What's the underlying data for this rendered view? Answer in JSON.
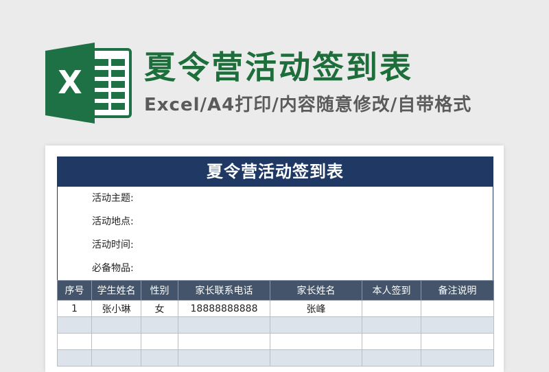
{
  "header": {
    "title": "夏令营活动签到表",
    "subtitle": "Excel/A4打印/内容随意修改/自带格式",
    "logo_letter": "X"
  },
  "sheet": {
    "title": "夏令营活动签到表",
    "info": [
      "活动主题:",
      "活动地点:",
      "活动时间:",
      "必备物品:"
    ],
    "columns": [
      "序号",
      "学生姓名",
      "性别",
      "家长联系电话",
      "家长姓名",
      "本人签到",
      "备注说明"
    ],
    "rows": [
      [
        "1",
        "张小琳",
        "女",
        "18888888888",
        "张峰",
        "",
        ""
      ],
      [
        "",
        "",
        "",
        "",
        "",
        "",
        ""
      ],
      [
        "",
        "",
        "",
        "",
        "",
        "",
        ""
      ],
      [
        "",
        "",
        "",
        "",
        "",
        "",
        ""
      ]
    ]
  },
  "colors": {
    "brand_green": "#1e6e3c",
    "title_bar": "#1f3864",
    "header_row": "#44546a",
    "shade_row": "#dde3ea"
  }
}
